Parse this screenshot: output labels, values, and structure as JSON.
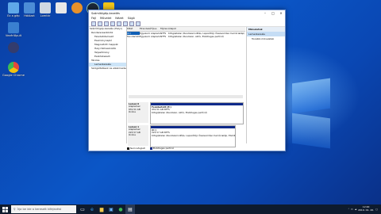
{
  "desktop": {
    "icons": [
      {
        "label": "Ez a gép",
        "color": "#5fa8e8"
      },
      {
        "label": "Hálózat",
        "color": "#4c8dd6"
      },
      {
        "label": "Lomtár",
        "color": "#cfd8e2"
      },
      {
        "label": "",
        "color": "#e8e8e8"
      },
      {
        "label": "",
        "color": "#e8912b"
      },
      {
        "label": "",
        "color": "#1b2838"
      },
      {
        "label": "",
        "color": "#f0c419"
      },
      {
        "label": "Vezérlőpult",
        "color": "#3a7fd0"
      },
      {
        "label": "",
        "color": "#333c6e"
      },
      {
        "label": "Google Chrome",
        "color": "#e44a3a"
      }
    ]
  },
  "window": {
    "title": "Számítógép-kezelés",
    "menus": [
      "Fájl",
      "Művelet",
      "Nézet",
      "Súgó"
    ],
    "tree": [
      "Számítógép-kezelés (Helyi)",
      "Rendszereszközök",
      "Feladatütemező",
      "Eseménynapló",
      "Megosztott mappák",
      "Helyi felhasználók",
      "Teljesítmény",
      "Eszközkezelő",
      "Tárolás",
      "Lemezkezelés",
      "Szolgáltatások és alkalmazások"
    ],
    "columns": [
      "Kötet",
      "Elrendezés",
      "Típus",
      "Fájlrendszer",
      "Állapot"
    ],
    "volumes": [
      [
        "(C:)",
        "Egyszerű",
        "Alaplemez",
        "NTFS",
        "Kifogástalan (Rendszerindítás, Lapozófájl, Összeomlási memóriakép)"
      ],
      [
        "Fenntartott (E:)",
        "Egyszerű",
        "Alaplemez",
        "NTFS",
        "Kifogástalan (Rendszer, Aktív, Elsődleges partíció)"
      ]
    ],
    "disks": [
      {
        "label": [
          "Lemez 0",
          "Alaplemez",
          "931,51 GB",
          "Online"
        ],
        "part": [
          "Fenntartott (E:)",
          "931,51 GB NTFS",
          "Kifogástalan (Rendszer, Aktív, Elsődleges partíció)"
        ]
      },
      {
        "label": [
          "Lemez 1",
          "Alaplemez",
          "223,57 GB",
          "Online"
        ],
        "part": [
          "(C:)",
          "223,57 GB NTFS",
          "Kifogástalan (Rendszerindítás, Lapozófájl, Összeomlási memóriakép, Elsődleges…"
        ]
      }
    ],
    "legend": [
      "Nem lefoglalt",
      "Elsődleges partíció"
    ],
    "actions": {
      "header": "Műveletek",
      "selected": "Lemezkezelés",
      "item": "További műveletek"
    }
  },
  "taskbar": {
    "search_placeholder": "Írja be ide a keresett kifejezést",
    "time": "12:00",
    "date": "2019. 01. 26."
  },
  "colors": {
    "primary_partition": "#0f2a8a",
    "unallocated": "#111111"
  }
}
